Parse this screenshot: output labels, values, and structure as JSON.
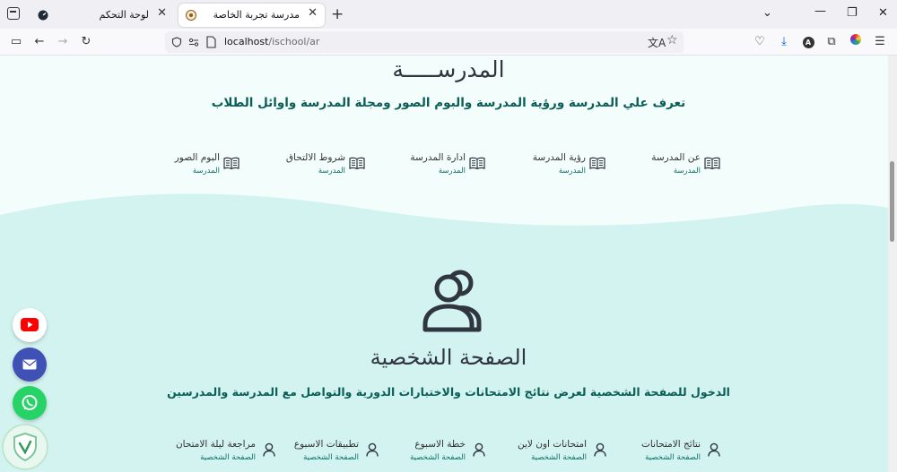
{
  "browser": {
    "tabs": [
      {
        "title": "لوحة التحكم",
        "active": false
      },
      {
        "title": "مدرسة تجربة الخاصة",
        "active": true
      }
    ],
    "url_host": "localhost",
    "url_path": "/ischool/ar"
  },
  "school_section": {
    "heading": "المدرســـــة",
    "subtitle": "تعرف علي المدرسة ورؤية المدرسة والبوم الصور ومجلة المدرسة واوائل الطلاب",
    "items": [
      {
        "label": "عن المدرسة",
        "category": "المدرسة",
        "icon": "book-icon"
      },
      {
        "label": "رؤية المدرسة",
        "category": "المدرسة",
        "icon": "book-icon"
      },
      {
        "label": "ادارة المدرسة",
        "category": "المدرسة",
        "icon": "book-icon"
      },
      {
        "label": "شروط الالتحاق",
        "category": "المدرسة",
        "icon": "book-icon"
      },
      {
        "label": "البوم الصور",
        "category": "المدرسة",
        "icon": "book-icon"
      }
    ]
  },
  "profile_section": {
    "heading": "الصفحة الشخصية",
    "subtitle": "الدخول للصفحة الشخصية لعرض نتائج الامتحانات والاختبارات الدورية والتواصل مع المدرسة والمدرسين",
    "items": [
      {
        "label": "نتائج الامتحانات",
        "category": "الصفحة الشخصية",
        "icon": "user-icon"
      },
      {
        "label": "امتحانات اون لاين",
        "category": "الصفحة الشخصية",
        "icon": "user-icon"
      },
      {
        "label": "خطة الاسبوع",
        "category": "الصفحة الشخصية",
        "icon": "user-icon"
      },
      {
        "label": "تطبيقات الاسبوع",
        "category": "الصفحة الشخصية",
        "icon": "user-icon"
      },
      {
        "label": "مراجعة ليلة الامتحان",
        "category": "الصفحة الشخصية",
        "icon": "user-icon"
      }
    ]
  },
  "colors": {
    "page_bg": "#f3fdfc",
    "wave_bg": "#d3f3f1",
    "accent": "#0a5e56",
    "heading": "#2f3640",
    "youtube": "#ff0000",
    "mail": "#3f51b5",
    "whatsapp": "#25d366"
  }
}
